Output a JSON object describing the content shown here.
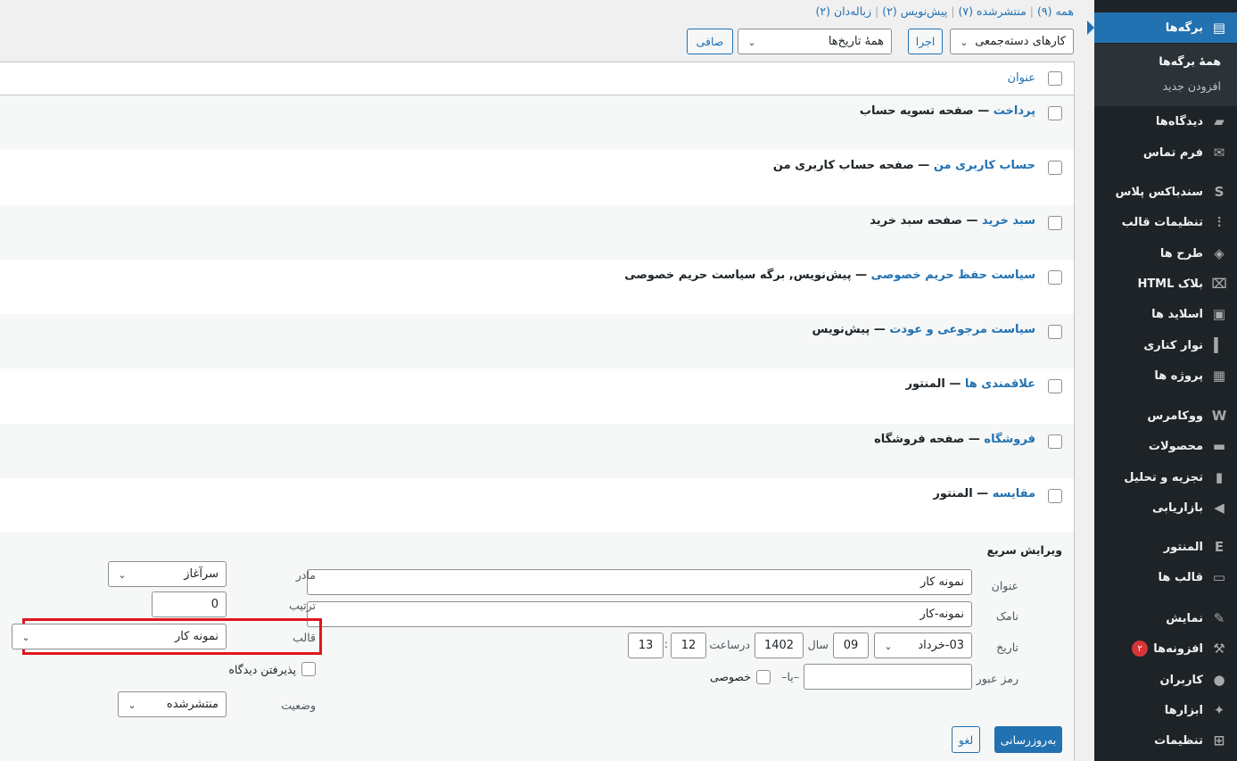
{
  "sidebar": {
    "items": [
      {
        "label": "برگه‌ها",
        "icon": "pages-icon",
        "glyph": "▤",
        "current": true
      },
      {
        "label": "دیدگاه‌ها",
        "icon": "comments-icon",
        "glyph": "▰"
      },
      {
        "label": "فرم تماس",
        "icon": "mail-icon",
        "glyph": "✉"
      },
      {
        "label": "سندباکس پلاس",
        "icon": "sandbox-s-icon",
        "glyph": "S"
      },
      {
        "label": "تنظیمات قالب",
        "icon": "sliders-icon",
        "glyph": "⫶"
      },
      {
        "label": "طرح ها",
        "icon": "layers-icon",
        "glyph": "◈"
      },
      {
        "label": "بلاک HTML",
        "icon": "code-block-icon",
        "glyph": "⌧"
      },
      {
        "label": "اسلاید ها",
        "icon": "slides-icon",
        "glyph": "▣"
      },
      {
        "label": "نوار کناری",
        "icon": "sidebar-icon",
        "glyph": "▍"
      },
      {
        "label": "پروژه ها",
        "icon": "briefcase-icon",
        "glyph": "▦"
      },
      {
        "label": "ووکامرس",
        "icon": "woocommerce-icon",
        "glyph": "W"
      },
      {
        "label": "محصولات",
        "icon": "archive-icon",
        "glyph": "▬"
      },
      {
        "label": "تجزیه و تحلیل",
        "icon": "chart-bar-icon",
        "glyph": "▮"
      },
      {
        "label": "بازاریابی",
        "icon": "megaphone-icon",
        "glyph": "◀"
      },
      {
        "label": "المنتور",
        "icon": "elementor-icon",
        "glyph": "E"
      },
      {
        "label": "قالب ها",
        "icon": "folder-icon",
        "glyph": "▭"
      },
      {
        "label": "نمایش",
        "icon": "paintbrush-icon",
        "glyph": "✎"
      },
      {
        "label": "افزونه‌ها",
        "icon": "plugins-icon",
        "glyph": "⚒",
        "badge": "۲"
      },
      {
        "label": "کاربران",
        "icon": "user-icon",
        "glyph": "●"
      },
      {
        "label": "ابزارها",
        "icon": "wrench-icon",
        "glyph": "✦"
      },
      {
        "label": "تنظیمات",
        "icon": "settings-icon",
        "glyph": "⊞"
      }
    ],
    "submenu": {
      "all_pages": "همهٔ برگه‌ها",
      "add_new": "افزودن جدید"
    }
  },
  "views": {
    "all": "همه (۹)",
    "published": "منتشرشده (۷)",
    "drafts": "پیش‌نویس (۲)",
    "trash": "زباله‌دان (۲)",
    "sep": "|"
  },
  "toolbar": {
    "bulk_actions": "کارهای دسته‌جمعی",
    "apply": "اجرا",
    "all_dates": "همهٔ تاریخ‌ها",
    "filter": "صافی"
  },
  "table": {
    "col_title": "عنوان",
    "rows": [
      {
        "title": "پرداخت",
        "desc": "صفحه تسویه حساب"
      },
      {
        "title": "حساب کاربری من",
        "desc": "صفحه حساب کاربری من"
      },
      {
        "title": "سبد خرید",
        "desc": "صفحه سبد خرید"
      },
      {
        "title": "سیاست حفظ حریم خصوصی",
        "desc": "پیش‌نویس, برگه سیاست حریم خصوصی"
      },
      {
        "title": "سیاست مرجوعی و عودت",
        "desc": "پیش‌نویس"
      },
      {
        "title": "علاقمندی ها",
        "desc": "المنتور"
      },
      {
        "title": "فروشگاه",
        "desc": "صفحه فروشگاه"
      },
      {
        "title": "مقایسه",
        "desc": "المنتور"
      }
    ],
    "dash": " — "
  },
  "quick_edit": {
    "heading": "ویرایش سریع",
    "title_label": "عنوان",
    "title_value": "نمونه کار",
    "slug_label": "نامک",
    "slug_value": "نمونه-کار",
    "date_label": "تاریخ",
    "month": "03-خرداد",
    "day": "09",
    "year_label": "سال",
    "year": "1402",
    "at_label": "درساعت",
    "hour": "12",
    "colon": ":",
    "minute": "13",
    "password_label": "رمز عبور",
    "or_label": "–یا–",
    "private_label": "خصوصی",
    "parent_label": "مادر",
    "parent_value": "سرآغاز",
    "order_label": "ترتیب",
    "order_value": "0",
    "template_label": "قالب",
    "template_value": "نمونه کار",
    "allow_comments": "پذیرفتن دیدگاه",
    "status_label": "وضعیت",
    "status_value": "منتشرشده",
    "update_button": "به‌روزرسانی",
    "cancel_button": "لغو"
  },
  "colors": {
    "accent": "#2271b1",
    "sidebar_bg": "#1d2327",
    "highlight": "#e0161e",
    "badge": "#d63638"
  }
}
